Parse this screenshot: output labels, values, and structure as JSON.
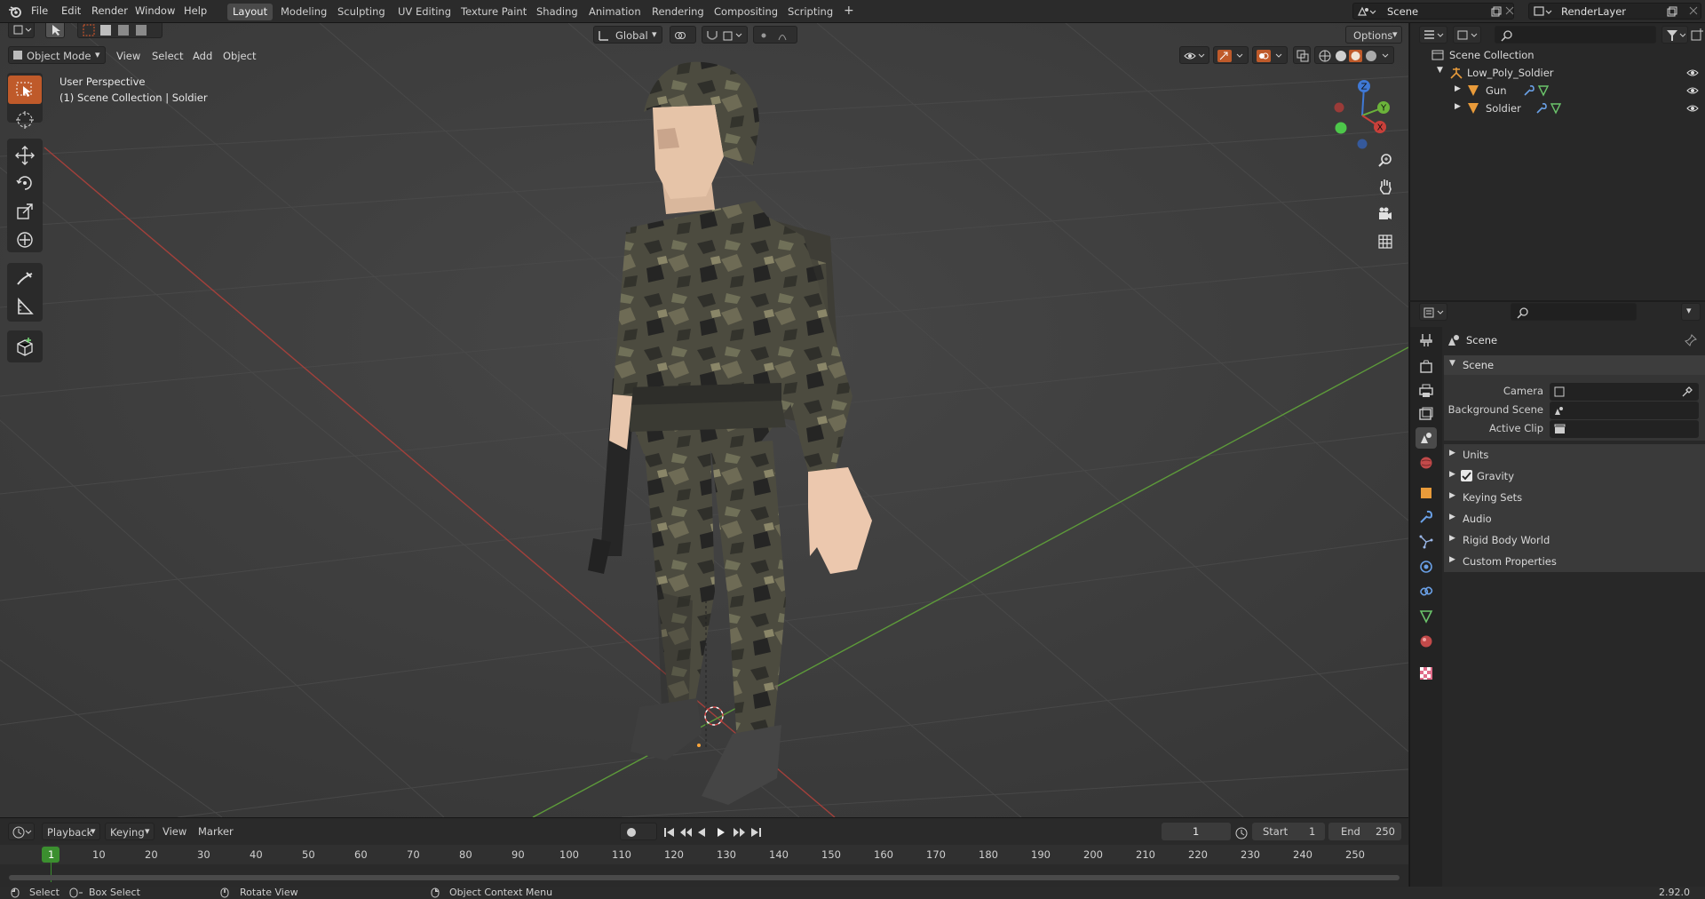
{
  "menu": {
    "items": [
      "File",
      "Edit",
      "Render",
      "Window",
      "Help"
    ]
  },
  "workspaces": {
    "tabs": [
      "Layout",
      "Modeling",
      "Sculpting",
      "UV Editing",
      "Texture Paint",
      "Shading",
      "Animation",
      "Rendering",
      "Compositing",
      "Scripting"
    ],
    "active": "Layout",
    "add_label": "+"
  },
  "scene_selector": {
    "value": "Scene"
  },
  "view_layer_selector": {
    "value": "RenderLayer"
  },
  "viewport_header": {
    "mode": "Object Mode",
    "menus": [
      "View",
      "Select",
      "Add",
      "Object"
    ],
    "transform_orientation": "Global",
    "options_label": "Options"
  },
  "viewport_overlay": {
    "line1": "User Perspective",
    "line2": "(1) Scene Collection | Soldier"
  },
  "gizmo": {
    "x": "X",
    "y": "Y",
    "z": "Z"
  },
  "outliner": {
    "root": "Scene Collection",
    "collection": "Low_Poly_Soldier",
    "objects": [
      "Gun",
      "Soldier"
    ]
  },
  "properties": {
    "context_title": "Scene",
    "section": "Scene",
    "fields": [
      {
        "label": "Camera",
        "value": ""
      },
      {
        "label": "Background Scene",
        "value": ""
      },
      {
        "label": "Active Clip",
        "value": ""
      }
    ],
    "panels": [
      "Units",
      "Gravity",
      "Keying Sets",
      "Audio",
      "Rigid Body World",
      "Custom Properties"
    ],
    "gravity_checked": true
  },
  "timeline": {
    "menus": [
      "Playback",
      "Keying",
      "View",
      "Marker"
    ],
    "current_frame": "1",
    "start_label": "Start",
    "start": "1",
    "end_label": "End",
    "end": "250",
    "ticks": [
      "1",
      "10",
      "20",
      "30",
      "40",
      "50",
      "60",
      "70",
      "80",
      "90",
      "100",
      "110",
      "120",
      "130",
      "140",
      "150",
      "160",
      "170",
      "180",
      "190",
      "200",
      "210",
      "220",
      "230",
      "240",
      "250"
    ]
  },
  "statusbar": {
    "select": "Select",
    "box_select": "Box Select",
    "rotate_view": "Rotate View",
    "context_menu": "Object Context Menu",
    "version": "2.92.0"
  },
  "colors": {
    "accent": "#bf5a2a",
    "axis_x": "#c8403a",
    "axis_y": "#6bb33a",
    "axis_z": "#3f79d6",
    "current_frame": "#3b8f2f"
  }
}
